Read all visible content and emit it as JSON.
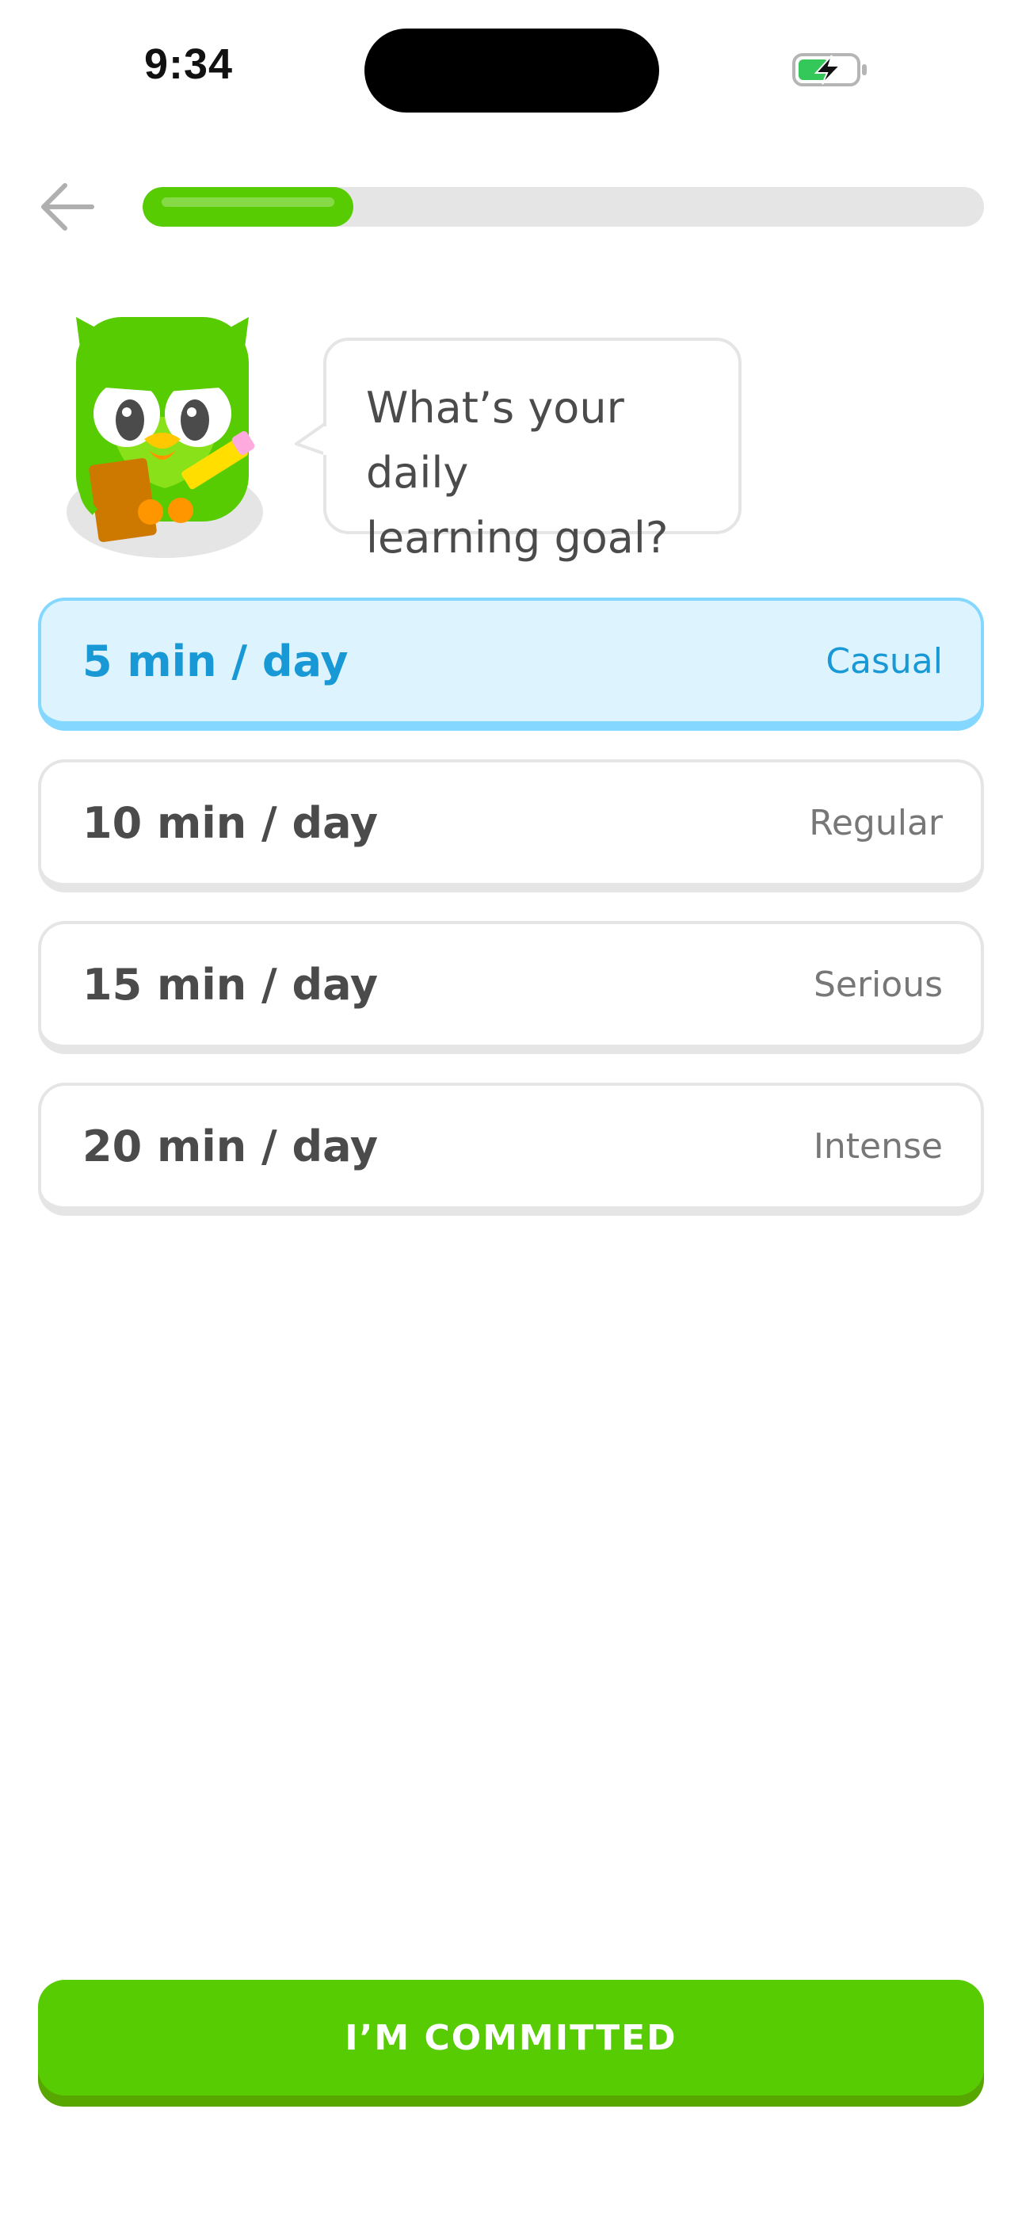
{
  "status_bar": {
    "time": "9:34",
    "battery_icon": "battery-charging-icon"
  },
  "header": {
    "back_icon": "arrow-left-icon",
    "progress": 0.25
  },
  "prompt": {
    "mascot": "owl-mascot-with-clipboard",
    "line1": "What’s your daily",
    "line2": "learning goal?"
  },
  "options": [
    {
      "label": "5 min / day",
      "level": "Casual",
      "selected": true
    },
    {
      "label": "10 min / day",
      "level": "Regular",
      "selected": false
    },
    {
      "label": "15 min / day",
      "level": "Serious",
      "selected": false
    },
    {
      "label": "20 min / day",
      "level": "Intense",
      "selected": false
    }
  ],
  "footer": {
    "commit_label": "I’M COMMITTED"
  },
  "colors": {
    "brand_green": "#58cc02",
    "selected_blue": "#1899d6",
    "selected_bg": "#ddf4ff",
    "selected_border": "#84d8ff"
  }
}
